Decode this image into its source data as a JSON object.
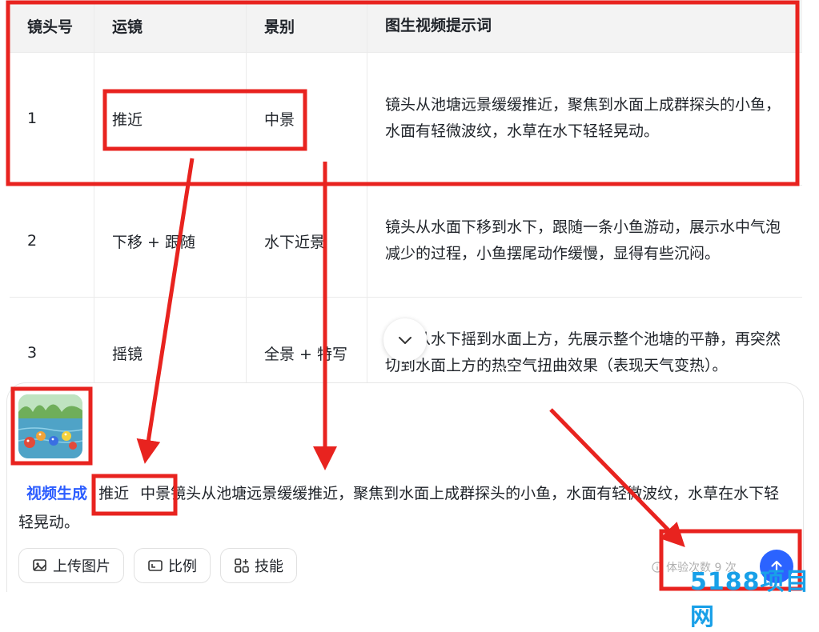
{
  "table": {
    "headers": [
      "镜头号",
      "运镜",
      "景别",
      "图生视频提示词"
    ],
    "rows": [
      {
        "no": "1",
        "move": "推近",
        "shot": "中景",
        "prompt": "镜头从池塘远景缓缓推近，聚焦到水面上成群探头的小鱼，水面有轻微波纹，水草在水下轻轻晃动。"
      },
      {
        "no": "2",
        "move": "下移 + 跟随",
        "shot": "水下近景",
        "prompt": "镜头从水面下移到水下，跟随一条小鱼游动，展示水中气泡减少的过程，小鱼摆尾动作缓慢，显得有些沉闷。"
      },
      {
        "no": "3",
        "move": "摇镜",
        "shot": "全景 + 特写",
        "prompt": "镜头从水下摇到水面上方，先展示整个池塘的平静，再突然切到水面上方的热空气扭曲效果（表现天气变热）。"
      }
    ]
  },
  "composer": {
    "tag": "视频生成",
    "move": "推近",
    "shot": "中景",
    "prompt": "镜头从池塘远景缓缓推近，聚焦到水面上成群探头的小鱼，水面有轻微波纹，水草在水下轻轻晃动。",
    "tools": {
      "upload": "上传图片",
      "ratio": "比例",
      "skill": "技能"
    },
    "quota": "体验次数 9 次"
  },
  "icons": [
    "chevron-down-icon",
    "image-upload-icon",
    "aspect-ratio-icon",
    "skills-grid-icon",
    "info-icon",
    "arrow-up-icon"
  ],
  "colors": {
    "accent": "#2b63ff",
    "annotation": "#e8231f",
    "watermark": "#19a0e8"
  },
  "watermark": "5188项目网"
}
